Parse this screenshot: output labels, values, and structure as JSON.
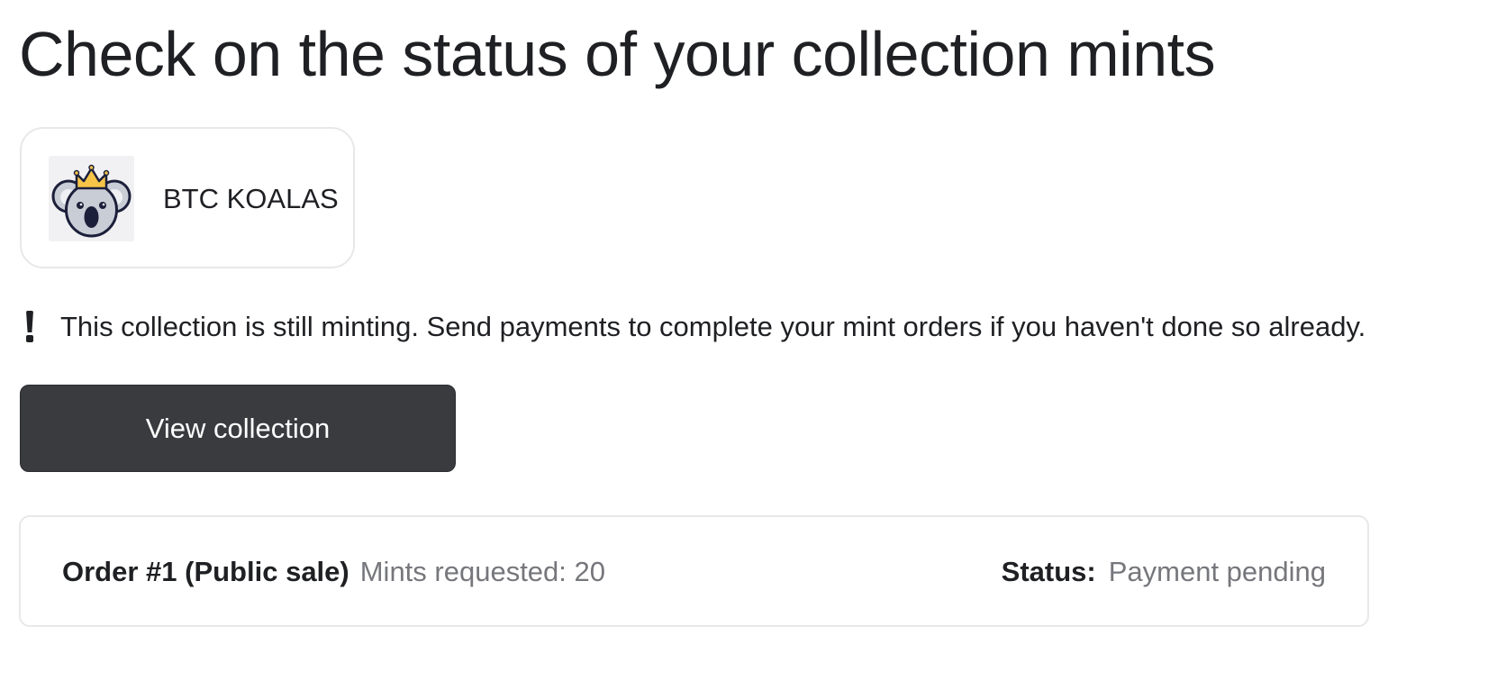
{
  "page": {
    "title": "Check on the status of your collection mints"
  },
  "collection": {
    "name": "BTC KOALAS",
    "thumbnail_icon": "koala-crown-icon"
  },
  "notice": {
    "icon": "exclamation-icon",
    "text": "This collection is still minting. Send payments to complete your mint orders if you haven't done so already."
  },
  "actions": {
    "view_collection_label": "View collection"
  },
  "orders": [
    {
      "title": "Order #1 (Public sale)",
      "mints_requested": "Mints requested: 20",
      "status_label": "Status:",
      "status_value": "Payment pending"
    }
  ],
  "colors": {
    "text_primary": "#1f2023",
    "text_muted": "#76777c",
    "button_bg": "#3a3b3f",
    "card_border": "#e8e8ea",
    "koala_crown": "#f6c548",
    "koala_fur": "#c9cdd6",
    "koala_outline": "#1c1f3a"
  }
}
